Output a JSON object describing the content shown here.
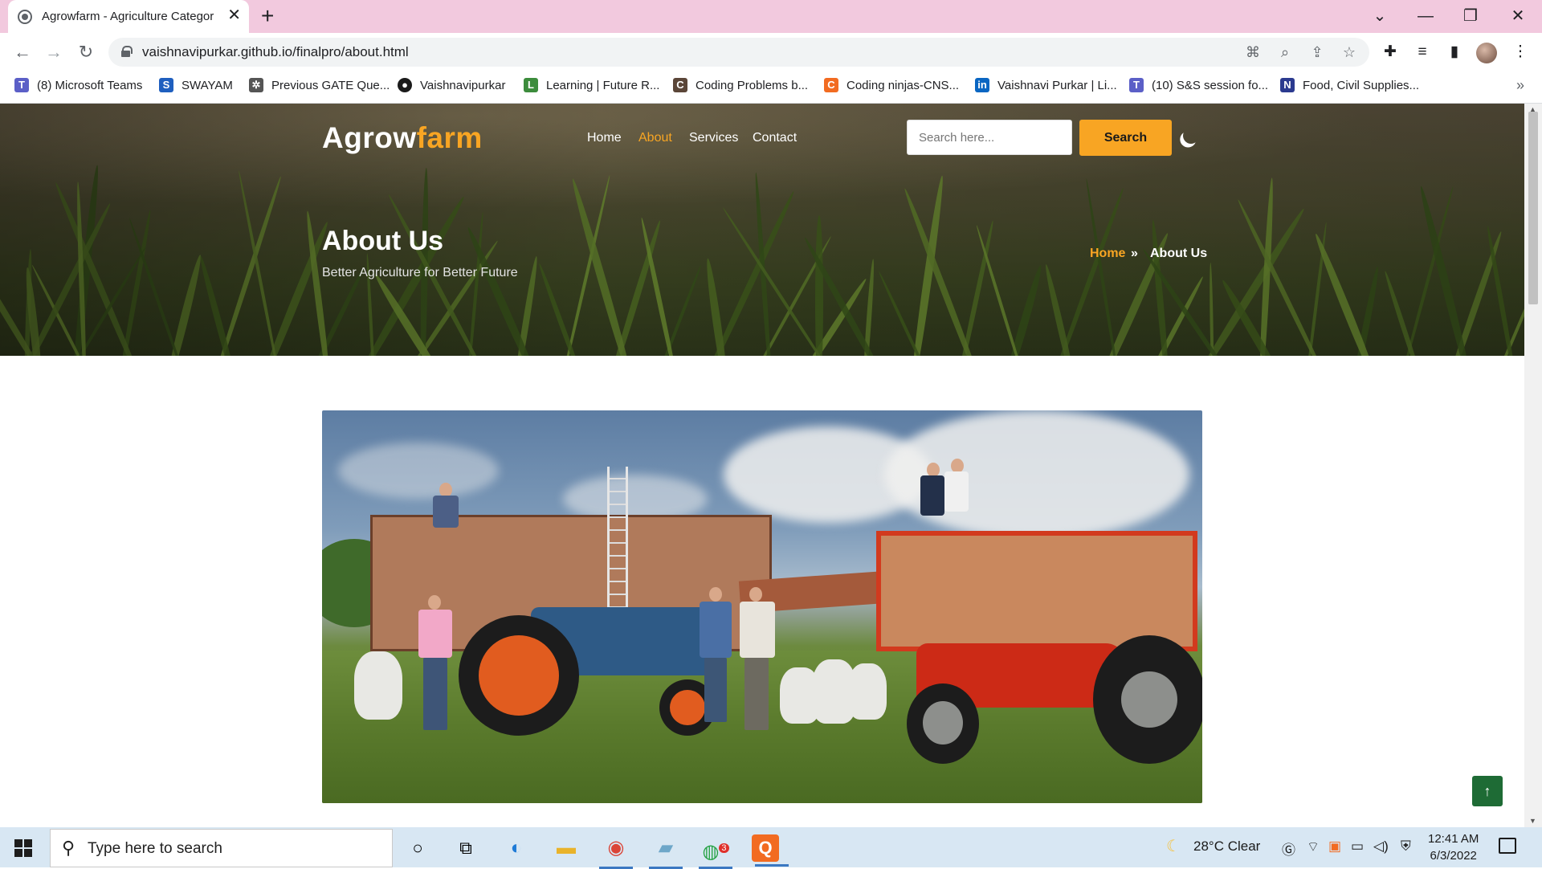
{
  "browser": {
    "tab_title": "Agrowfarm - Agriculture Categor",
    "url": "vaishnavipurkar.github.io/finalpro/about.html",
    "bookmarks": [
      {
        "label": "(8) Microsoft Teams",
        "icon": "teams-icon",
        "color": "#5b5fc7"
      },
      {
        "label": "SWAYAM",
        "icon": "swayam-icon",
        "color": "#1f5fbf"
      },
      {
        "label": "Previous GATE Que...",
        "icon": "gate-icon",
        "color": "#555555"
      },
      {
        "label": "Vaishnavipurkar",
        "icon": "github-icon",
        "color": "#1a1a1a"
      },
      {
        "label": "Learning | Future R...",
        "icon": "learning-icon",
        "color": "#3c8c3c"
      },
      {
        "label": "Coding Problems b...",
        "icon": "codechef-icon",
        "color": "#5b4638"
      },
      {
        "label": "Coding ninjas-CNS...",
        "icon": "codingninjas-icon",
        "color": "#f26b21"
      },
      {
        "label": "Vaishnavi Purkar | Li...",
        "icon": "linkedin-icon",
        "color": "#0a66c2"
      },
      {
        "label": "(10) S&S session fo...",
        "icon": "teams-icon",
        "color": "#5b5fc7"
      },
      {
        "label": "Food, Civil Supplies...",
        "icon": "nic-icon",
        "color": "#2b3a8f"
      }
    ]
  },
  "site": {
    "logo_main": "Agrow",
    "logo_accent": "farm",
    "nav": [
      "Home",
      "About",
      "Services",
      "Contact"
    ],
    "active_nav": "About",
    "search_placeholder": "Search here...",
    "search_button": "Search",
    "page_title": "About Us",
    "page_subtitle": "Better Agriculture for Better Future",
    "breadcrumb": {
      "home": "Home",
      "separator": "»",
      "current": "About Us"
    },
    "accent_color": "#f8a523",
    "to_top_symbol": "↑"
  },
  "taskbar": {
    "search_placeholder": "Type here to search",
    "weather": "28°C  Clear",
    "time": "12:41 AM",
    "date": "6/3/2022",
    "badge_count": "3"
  }
}
